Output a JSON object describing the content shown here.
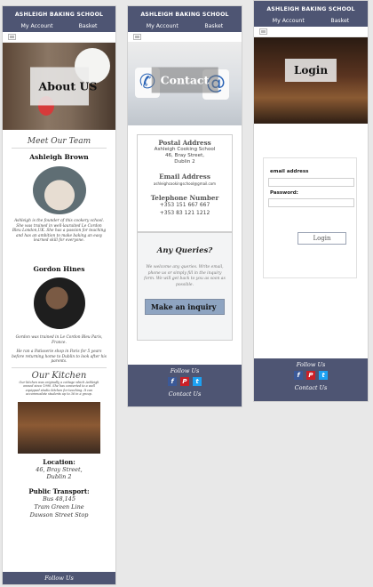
{
  "brand": "ASHLEIGH BAKING SCHOOL",
  "nav": {
    "account": "My Account",
    "basket": "Basket"
  },
  "about_page": {
    "hero_title": "About US",
    "team_heading": "Meet Our Team",
    "members": [
      {
        "name": "Ashleigh Brown",
        "bio": "Ashleigh is the founder of this cookery school. She was trained in well-lauraited Le Cordon Bleu London,UK. She has a passion for teaching and has an ambition to make baking an easy learned skill for everyone."
      },
      {
        "name": "Gordon Hines",
        "bio": "Gordon was trained in Le Cordon Bleu Paris, France.",
        "bio2": "He ran a Patisserie shop in Paris for 5 years before returning home to Dublin to look after his parents."
      }
    ],
    "kitchen_heading": "Our Kitchen",
    "kitchen_text": "Our kitchen was originally a cottage which Ashleigh owned since 1990. She has converted to a well equipped studio kitchen for teaching. It can accommodate students up to 36 in a group.",
    "location_label": "Location:",
    "location_lines": [
      "46, Bray Street,",
      "Dublin 2"
    ],
    "transport_label": "Public Transport:",
    "transport_lines": [
      "Bus 48,145",
      "Tram Green Line",
      "Dawson Street Stop"
    ],
    "footer_follow": "Follow Us"
  },
  "contact_page": {
    "hero_title": "Contact",
    "postal_title": "Postal Address",
    "postal_lines": [
      "Ashleigh Cooking School",
      "46, Bray Street,",
      "Dublin 2"
    ],
    "email_title": "Email Address",
    "email_value": "ashleighcookingschool@gmail.com",
    "phone_title": "Telephone Number",
    "phone_lines": [
      "+353 151 667 667",
      "+353 83 121 1212"
    ],
    "queries_title": "Any Queries?",
    "queries_text": "We welcome any queries. Write email, phone us or simply fill in the inquiry form. We will get back to you as soon as possible.",
    "inquiry_button": "Make an inquiry",
    "footer_follow": "Follow Us",
    "footer_contact": "Contact Us"
  },
  "login_page": {
    "hero_title": "Login",
    "email_label": "email address",
    "password_label": "Password:",
    "login_button": "Login",
    "footer_follow": "Follow Us",
    "footer_contact": "Contact Us"
  },
  "social_icons": [
    "facebook-icon",
    "pinterest-icon",
    "twitter-icon"
  ],
  "colors": {
    "nav": "#4e5573",
    "footer": "#4e5573",
    "button": "#8ea4c1",
    "facebook": "#3b5998",
    "pinterest": "#cb2027",
    "twitter": "#1da1f2"
  }
}
